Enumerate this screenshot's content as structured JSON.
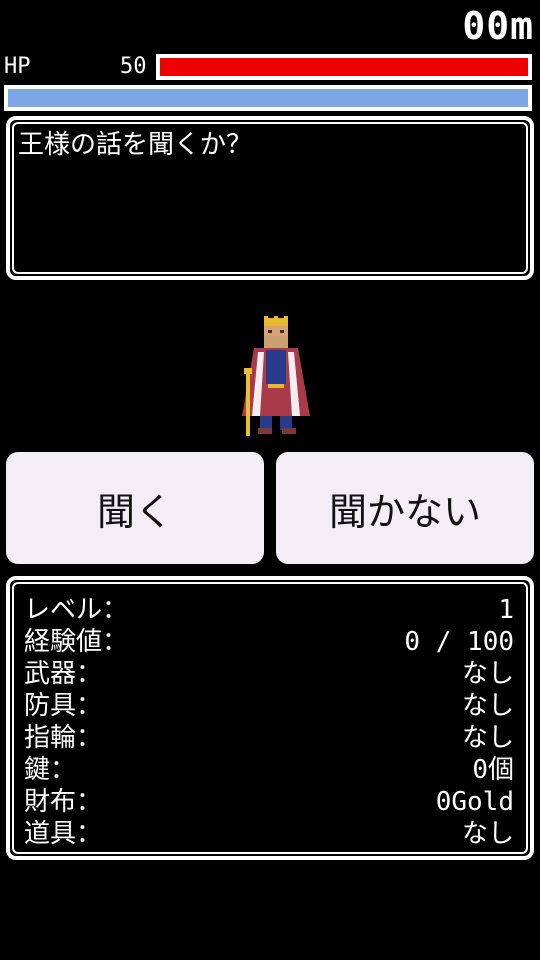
{
  "header": {
    "distance": "00m",
    "hp_label": "HP",
    "hp_value": "50",
    "hp_fraction": 1.0,
    "exp_fraction": 1.0
  },
  "colors": {
    "hp": "#ee0000",
    "bar2": "#7ba7e6",
    "button_bg": "#f3eef6",
    "background": "#000000"
  },
  "message": {
    "text": "王様の話を聞くか？"
  },
  "character": {
    "icon": "king-sprite"
  },
  "choices": {
    "listen_label": "聞く",
    "ignore_label": "聞かない"
  },
  "status": [
    {
      "label": "レベル：",
      "value": "1"
    },
    {
      "label": "経験値：",
      "value": "0 / 100"
    },
    {
      "label": "武器：",
      "value": "なし"
    },
    {
      "label": "防具：",
      "value": "なし"
    },
    {
      "label": "指輪：",
      "value": "なし"
    },
    {
      "label": "鍵：",
      "value": "0個"
    },
    {
      "label": "財布：",
      "value": "0Gold"
    },
    {
      "label": "道具：",
      "value": "なし"
    }
  ]
}
